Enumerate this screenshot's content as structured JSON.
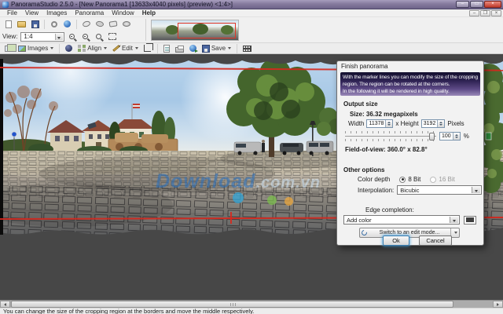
{
  "window": {
    "title": "PanoramaStudio 2.5.0 - [New Panorama1 [13633x4040 pixels] (preview) <1:4>]",
    "minimize": "–",
    "maximize": "□",
    "close": "×"
  },
  "menu": {
    "items": [
      "File",
      "View",
      "Images",
      "Panorama",
      "Window",
      "Help"
    ]
  },
  "toolbar": {
    "view_label": "View:",
    "view_value": "1:4"
  },
  "edit_toolbar": {
    "images_label": "Images",
    "align_label": "Align",
    "edit_label": "Edit",
    "save_label": "Save"
  },
  "dialog": {
    "title": "Finish panorama",
    "info_line1": "With the marker lines you can modify the size of the cropping",
    "info_line2": "region. The region can be rotated at the corners.",
    "info_line3": "In the following it will be rendered in high quality.",
    "output": {
      "heading": "Output size",
      "size_text": "Size: 36.32 megapixels",
      "width_label": "Width",
      "width_value": "11378",
      "height_label": "x Height",
      "height_value": "3192",
      "pixels_label": "Pixels",
      "scale_value": "100",
      "percent_label": "%",
      "fov_text": "Field-of-view: 360.0° x 82.8°"
    },
    "options": {
      "heading": "Other options",
      "color_depth_label": "Color depth",
      "bit8_label": "8 Bit",
      "bit16_label": "16 Bit",
      "interpolation_label": "Interpolation:",
      "interpolation_value": "Bicubic",
      "edge_label": "Edge completion:",
      "edge_value": "Add color",
      "switch_label": "Switch to an edit mode..."
    },
    "ok_label": "Ok",
    "cancel_label": "Cancel"
  },
  "watermark": {
    "part1": "Download",
    "part2": ".com.vn"
  },
  "status": {
    "text": "You can change the size of the cropping region at the borders and move the middle respectively."
  },
  "colors": {
    "marker_red": "#d6281e",
    "workspace_gray": "#474747",
    "titlebar_purple": "#867b9e",
    "dialog_info_top": "#14102e",
    "dialog_info_bottom": "#9a8ab8",
    "watermark_blue": "#2670c0",
    "dot_blue": "#2fa8dd",
    "dot_green": "#7cc14b",
    "dot_orange": "#f0a93c"
  }
}
